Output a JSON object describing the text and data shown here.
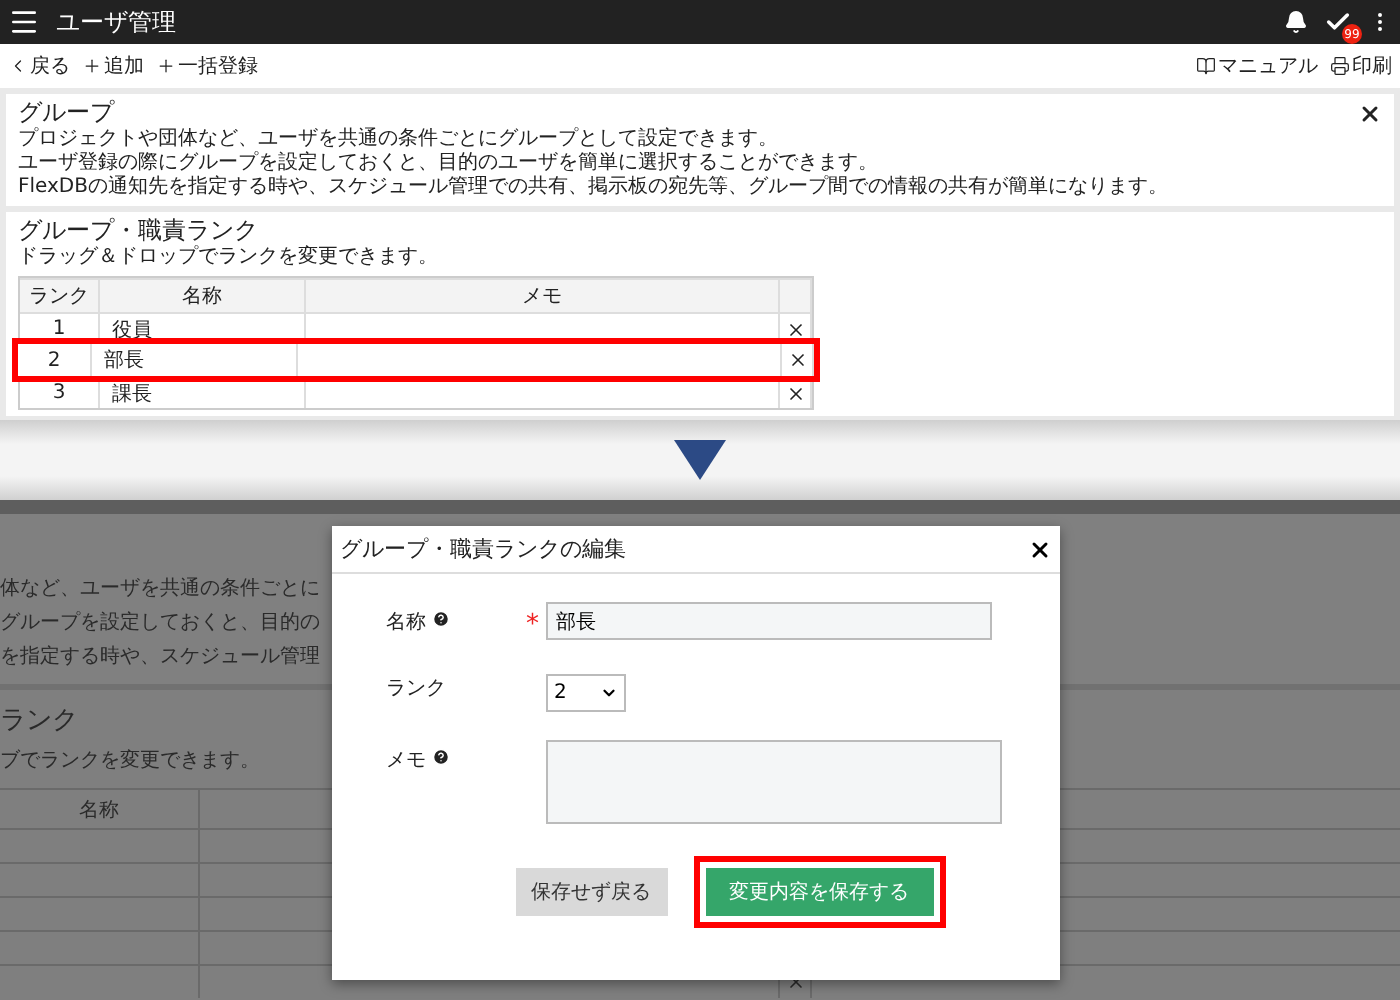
{
  "app_bar": {
    "title": "ユーザ管理",
    "badge": "99"
  },
  "toolbar": {
    "left": [
      {
        "kind": "back",
        "label": "戻る"
      },
      {
        "kind": "add",
        "label": "追加"
      },
      {
        "kind": "add",
        "label": "一括登録"
      }
    ],
    "right": [
      {
        "kind": "manual",
        "label": "マニュアル"
      },
      {
        "kind": "print",
        "label": "印刷"
      }
    ]
  },
  "group_card": {
    "title": "グループ",
    "lines": [
      "プロジェクトや団体など、ユーザを共通の条件ごとにグループとして設定できます。",
      "ユーザ登録の際にグループを設定しておくと、目的のユーザを簡単に選択することができます。",
      "FlexDBの通知先を指定する時や、スケジュール管理での共有、掲示板の宛先等、グループ間での情報の共有が簡単になります。"
    ]
  },
  "rank_card": {
    "title": "グループ・職責ランク",
    "hint": "ドラッグ＆ドロップでランクを変更できます。",
    "columns": [
      "ランク",
      "名称",
      "メモ"
    ],
    "rows": [
      {
        "rank": "1",
        "name": "役員",
        "highlighted": false
      },
      {
        "rank": "2",
        "name": "部長",
        "highlighted": true
      },
      {
        "rank": "3",
        "name": "課長",
        "highlighted": false
      }
    ]
  },
  "dimmed_page": {
    "lines": [
      "体など、ユーザを共通の条件ごとに",
      "グループを設定しておくと、目的の",
      "を指定する時や、スケジュール管理"
    ],
    "section_title": "ランク",
    "hint": "ブでランクを変更できます。",
    "column": "名称"
  },
  "dialog": {
    "title": "グループ・職責ランクの編集",
    "fields": [
      {
        "kind": "text",
        "label": "名称",
        "help": true,
        "required_mark": "*",
        "value": "部長"
      },
      {
        "kind": "select",
        "label": "ランク",
        "value": "2"
      },
      {
        "kind": "textarea",
        "label": "メモ",
        "help": true
      }
    ],
    "buttons": [
      {
        "kind": "secondary",
        "label": "保存せず戻る",
        "highlighted": false
      },
      {
        "kind": "primary",
        "label": "変更内容を保存する",
        "highlighted": true
      }
    ]
  }
}
